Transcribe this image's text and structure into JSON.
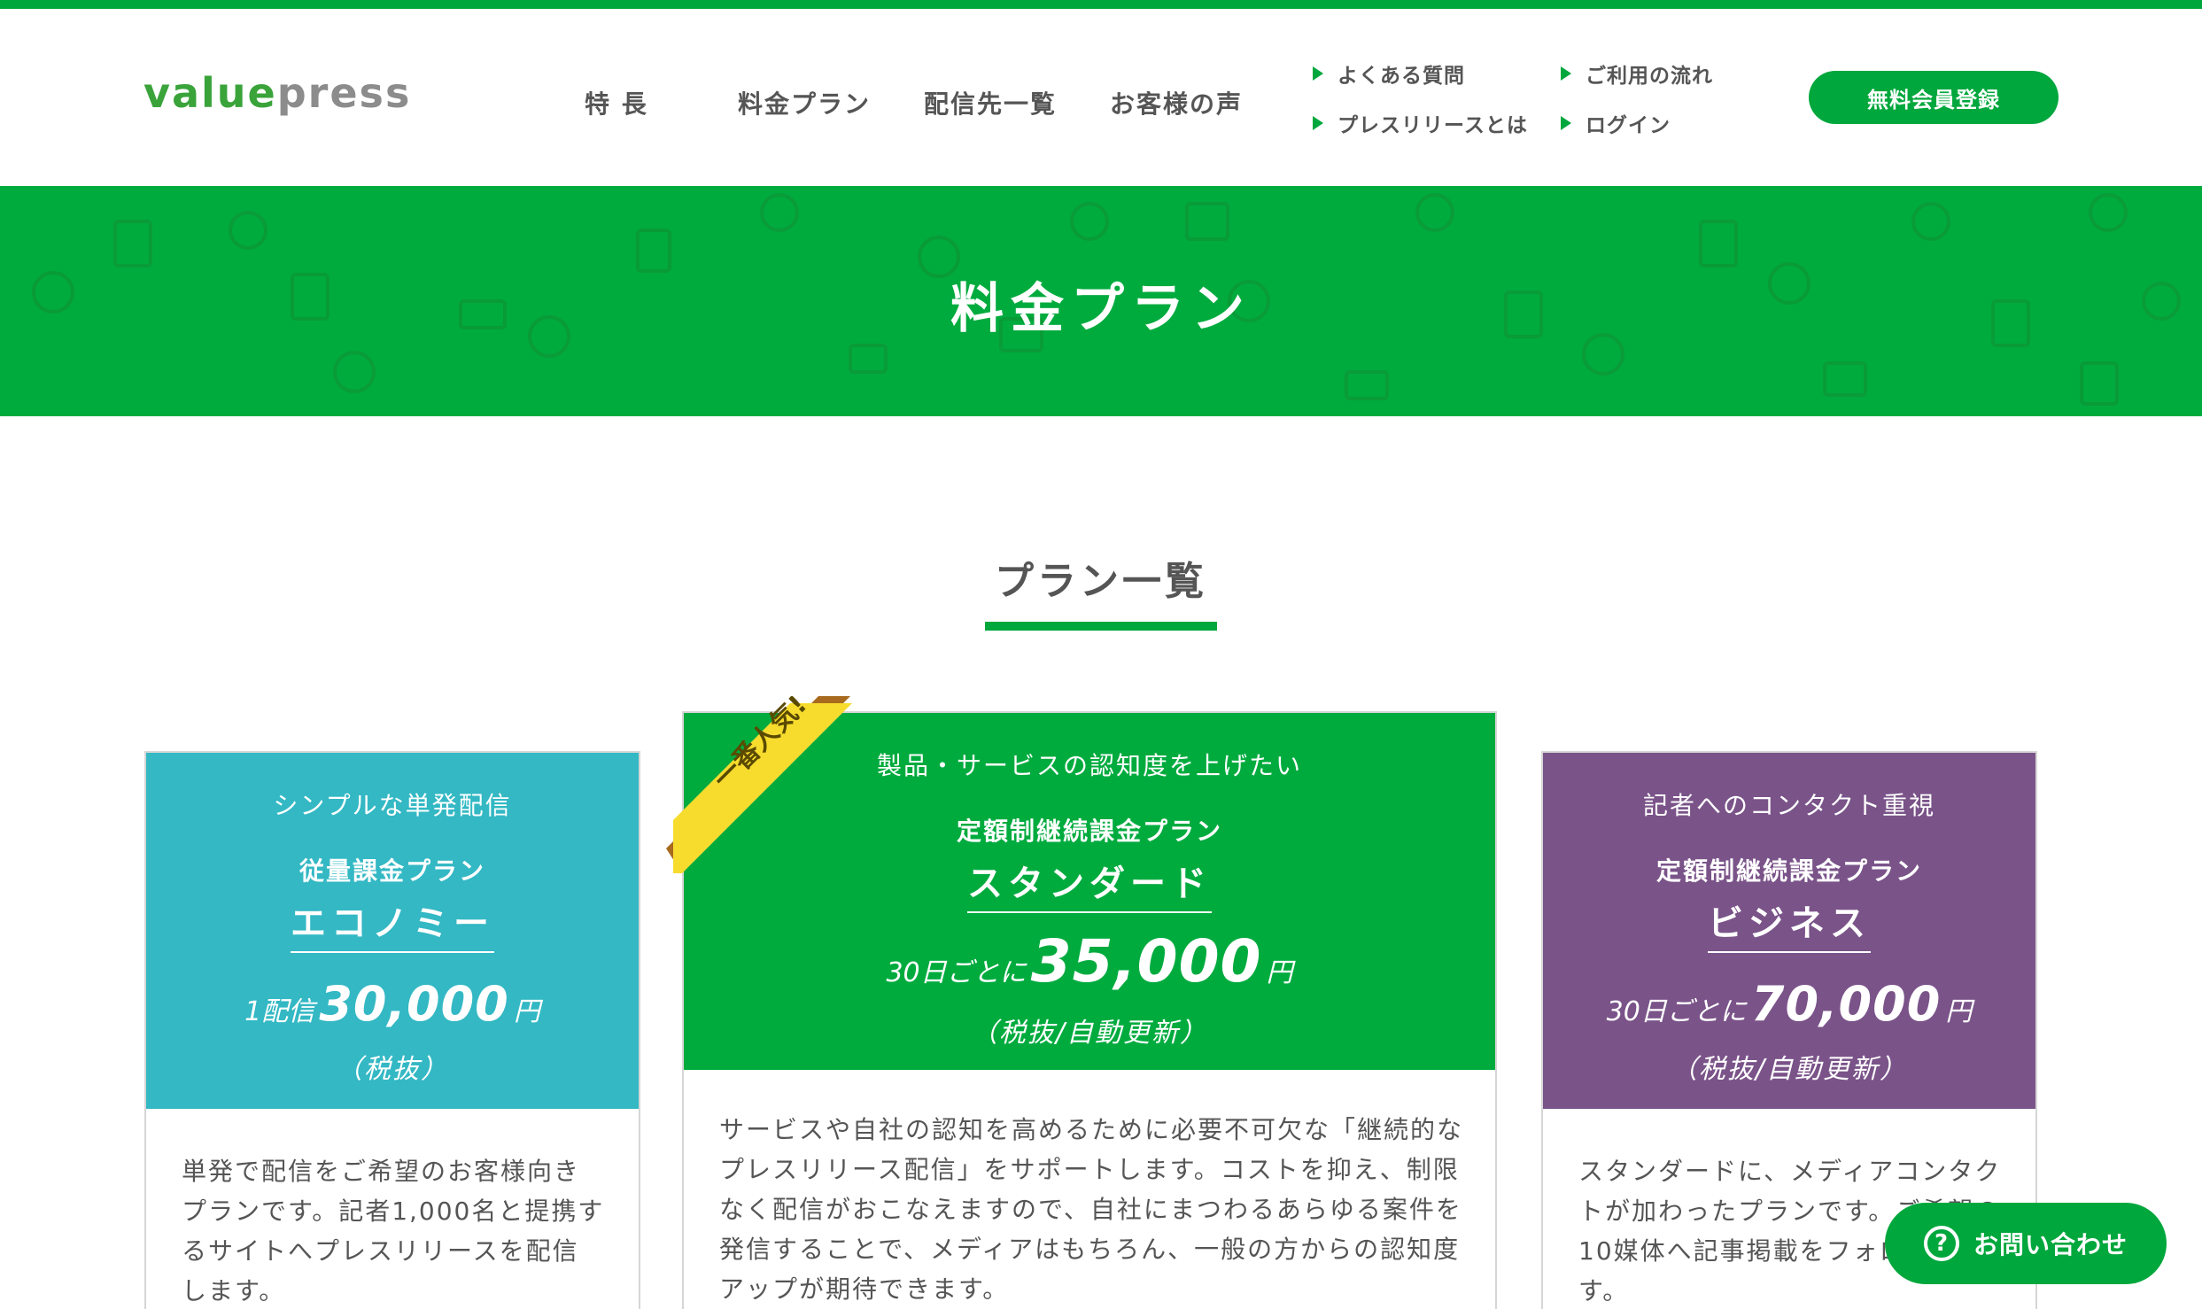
{
  "brand": {
    "logo_green": "value",
    "logo_gray": "press",
    "accent": "#00a73c"
  },
  "nav": {
    "main": [
      "特 長",
      "料金プラン",
      "配信先一覧",
      "お客様の声"
    ],
    "sub": [
      "よくある質問",
      "ご利用の流れ",
      "プレスリリースとは",
      "ログイン"
    ],
    "register": "無料会員登録"
  },
  "hero": {
    "title": "料金プラン"
  },
  "section": {
    "title": "プラン一覧"
  },
  "plans": [
    {
      "subtitle": "シンプルな単発配信",
      "type": "従量課金プラン",
      "name": "エコノミー",
      "price_prefix": "1配信",
      "price": "30,000",
      "unit": "円",
      "tax": "（税抜）",
      "description": "単発で配信をご希望のお客様向きプランです。記者1,000名と提携するサイトへプレスリリースを配信します。",
      "color": "#33b8c4"
    },
    {
      "subtitle": "製品・サービスの認知度を上げたい",
      "type": "定額制継続課金プラン",
      "name": "スタンダード",
      "price_prefix": "30日ごとに",
      "price": "35,000",
      "unit": "円",
      "tax": "（税抜/自動更新）",
      "description": "サービスや自社の認知を高めるために必要不可欠な「継続的なプレスリリース配信」をサポートします。コストを抑え、制限なく配信がおこなえますので、自社にまつわるあらゆる案件を発信することで、メディアはもちろん、一般の方からの認知度アップが期待できます。",
      "ribbon": "一番人気!",
      "color": "#00ab3e"
    },
    {
      "subtitle": "記者へのコンタクト重視",
      "type": "定額制継続課金プラン",
      "name": "ビジネス",
      "price_prefix": "30日ごとに",
      "price": "70,000",
      "unit": "円",
      "tax": "（税抜/自動更新）",
      "description": "スタンダードに、メディアコンタクトが加わったプランです。ご希望の10媒体へ記事掲載をフォローします。",
      "color": "#7a5389"
    }
  ],
  "contact": {
    "label": "お問い合わせ",
    "icon": "question-icon"
  }
}
